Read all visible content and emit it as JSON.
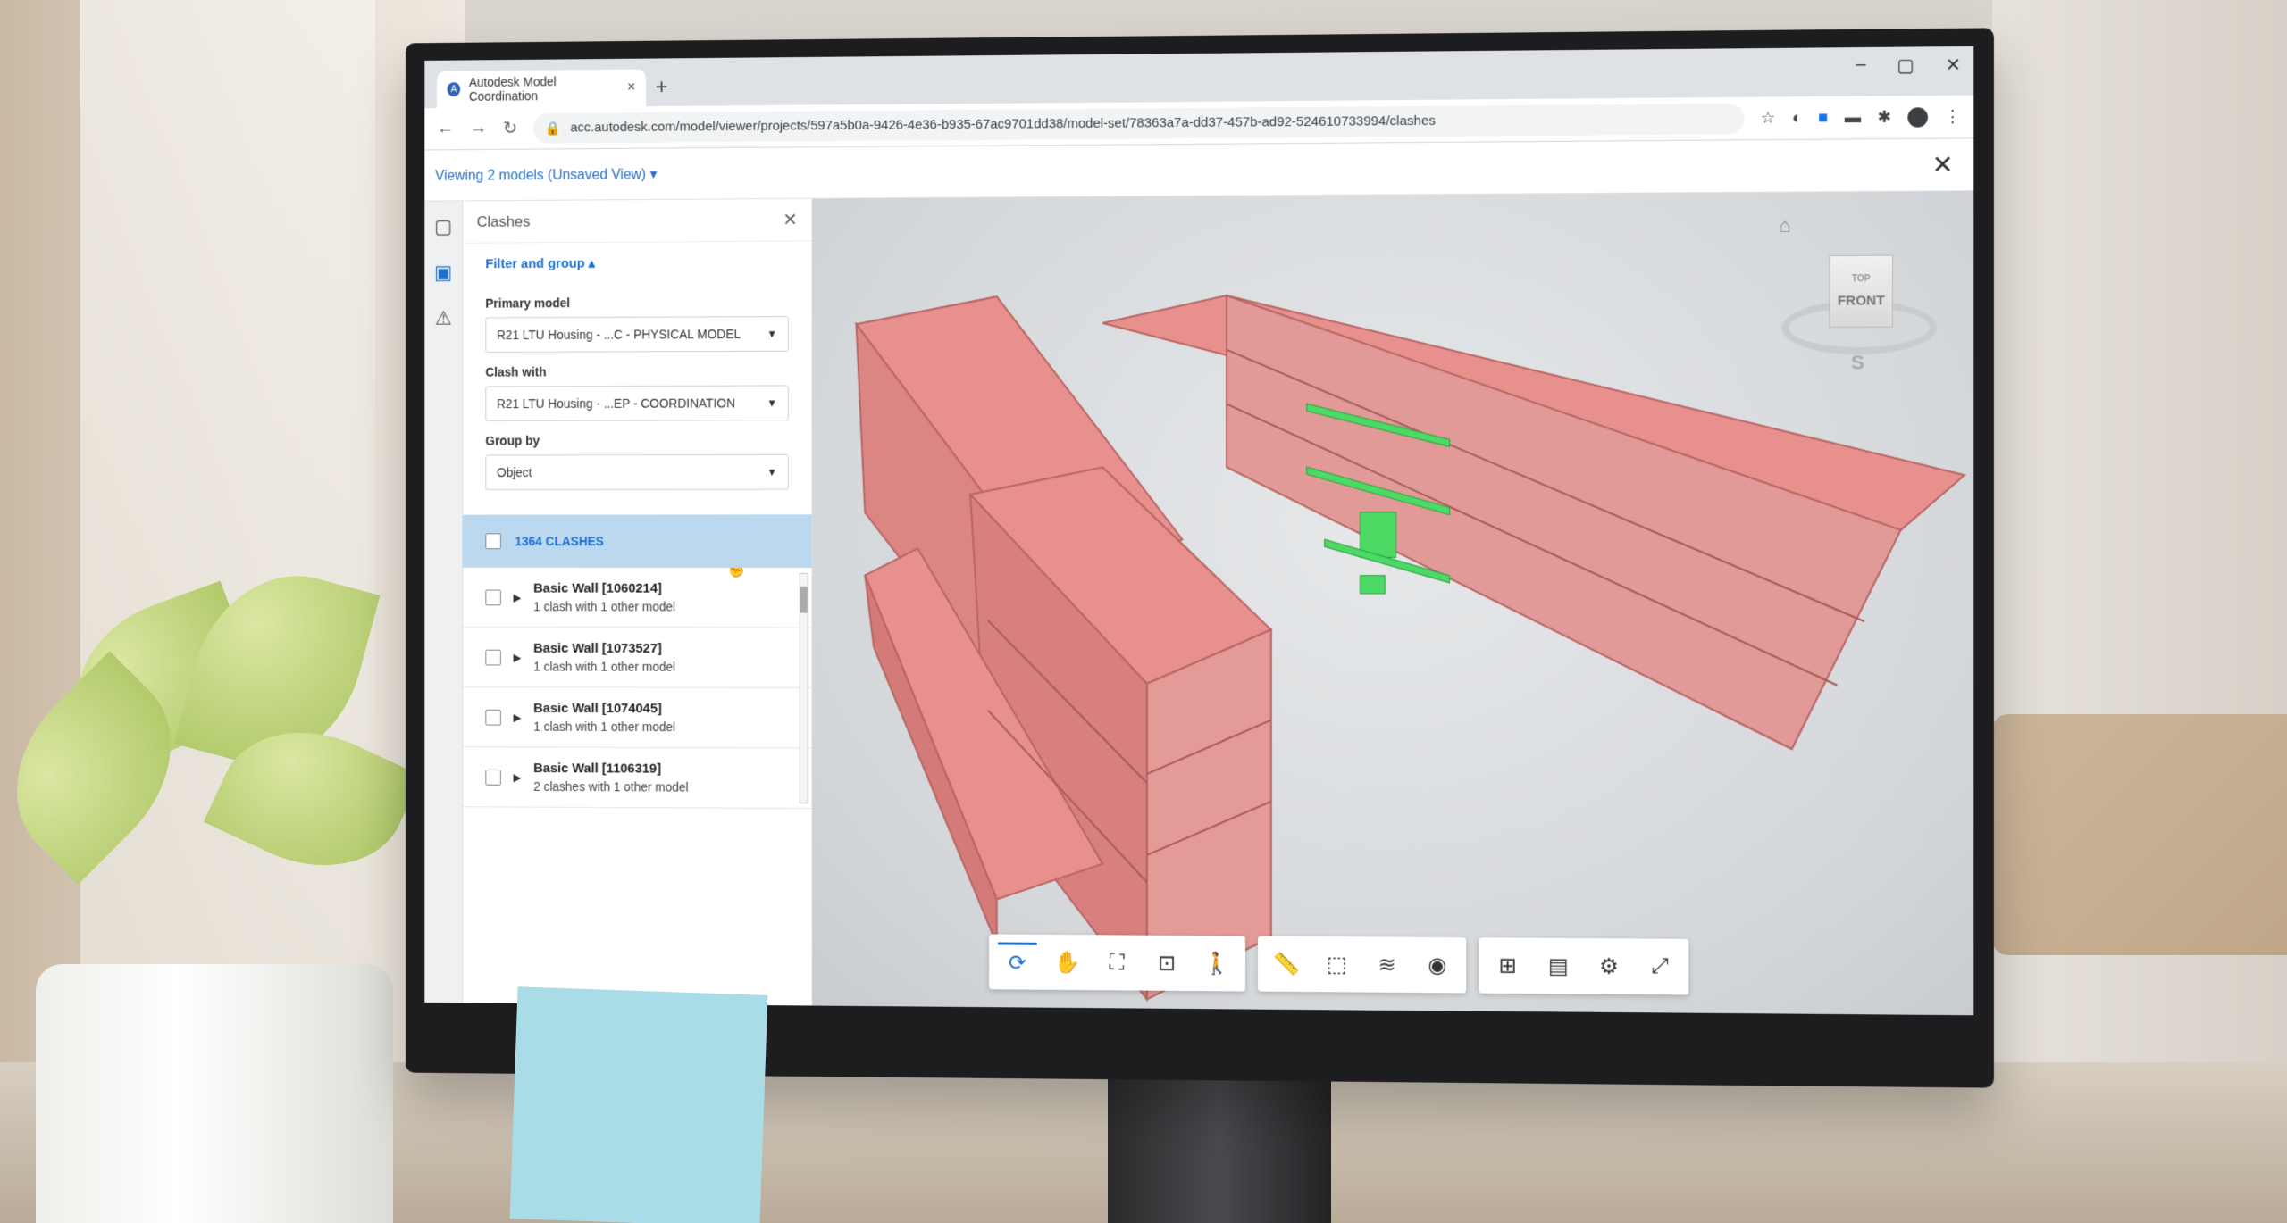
{
  "browser": {
    "tab_title": "Autodesk Model Coordination",
    "tab_close": "×",
    "new_tab": "+",
    "url": "acc.autodesk.com/model/viewer/projects/597a5b0a-9426-4e36-b935-67ac9701dd38/model-set/78363a7a-dd37-457b-ad92-524610733994/clashes",
    "window_controls": [
      "–",
      "▢",
      "✕"
    ]
  },
  "viewer": {
    "models_label": "Viewing 2 models (Unsaved View) ▾",
    "close": "✕"
  },
  "panel": {
    "title": "Clashes",
    "close": "✕",
    "filter_group": "Filter and group ▴",
    "primary_model_label": "Primary model",
    "primary_model_value": "R21 LTU Housing - ...C - PHYSICAL MODEL",
    "clash_with_label": "Clash with",
    "clash_with_value": "R21 LTU Housing - ...EP - COORDINATION",
    "group_by_label": "Group by",
    "group_by_value": "Object",
    "clash_count": "1364 CLASHES",
    "rows": [
      {
        "title": "Basic Wall [1060214]",
        "sub": "1 clash with 1 other model"
      },
      {
        "title": "Basic Wall [1073527]",
        "sub": "1 clash with 1 other model"
      },
      {
        "title": "Basic Wall [1074045]",
        "sub": "1 clash with 1 other model"
      },
      {
        "title": "Basic Wall [1106319]",
        "sub": "2 clashes with 1 other model"
      }
    ]
  },
  "viewcube": {
    "face": "FRONT",
    "top": "TOP",
    "compass_s": "S"
  },
  "colors": {
    "accent": "#1f6fd1",
    "model_red": "#e8908e",
    "clash_green": "#4cd964"
  }
}
